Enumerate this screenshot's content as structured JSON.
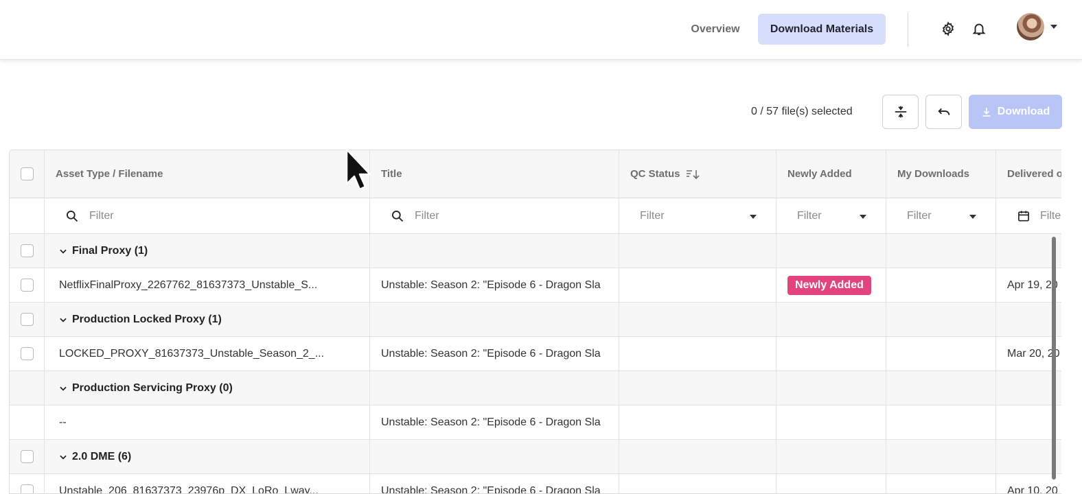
{
  "header": {
    "nav_overview": "Overview",
    "nav_download_materials": "Download Materials",
    "accent_color": "#d7defb"
  },
  "toolbar": {
    "selection_text": "0 / 57 file(s) selected",
    "download_label": "Download"
  },
  "table": {
    "columns": [
      "Asset Type / Filename",
      "Title",
      "QC Status",
      "Newly Added",
      "My Downloads",
      "Delivered o"
    ],
    "filters": {
      "filename_placeholder": "Filter",
      "title_placeholder": "Filter",
      "qc_status": "Filter",
      "newly_added": "Filter",
      "my_downloads": "Filter",
      "delivered": "Filte"
    },
    "rows": [
      {
        "type": "group",
        "label": "Final Proxy (1)"
      },
      {
        "type": "data",
        "filename": "NetflixFinalProxy_2267762_81637373_Unstable_S...",
        "title": "Unstable: Season 2: \"Episode 6 - Dragon Sla",
        "badge": "Newly Added",
        "delivered": "Apr 19, 20"
      },
      {
        "type": "group",
        "label": "Production Locked Proxy (1)"
      },
      {
        "type": "data",
        "filename": "LOCKED_PROXY_81637373_Unstable_Season_2_...",
        "title": "Unstable: Season 2: \"Episode 6 - Dragon Sla",
        "delivered": "Mar 20, 20"
      },
      {
        "type": "group",
        "label": "Production Servicing Proxy (0)"
      },
      {
        "type": "data",
        "filename": "--",
        "title": "Unstable: Season 2: \"Episode 6 - Dragon Sla",
        "delivered": ""
      },
      {
        "type": "group",
        "label": "2.0 DME (6)"
      },
      {
        "type": "data",
        "filename": "Unstable_206_81637373_23976p_DX_LoRo_Lway...",
        "title": "Unstable: Season 2: \"Episode 6 - Dragon Sla",
        "delivered": "Apr 10, 20"
      }
    ],
    "badge_color": "#e2447e"
  }
}
